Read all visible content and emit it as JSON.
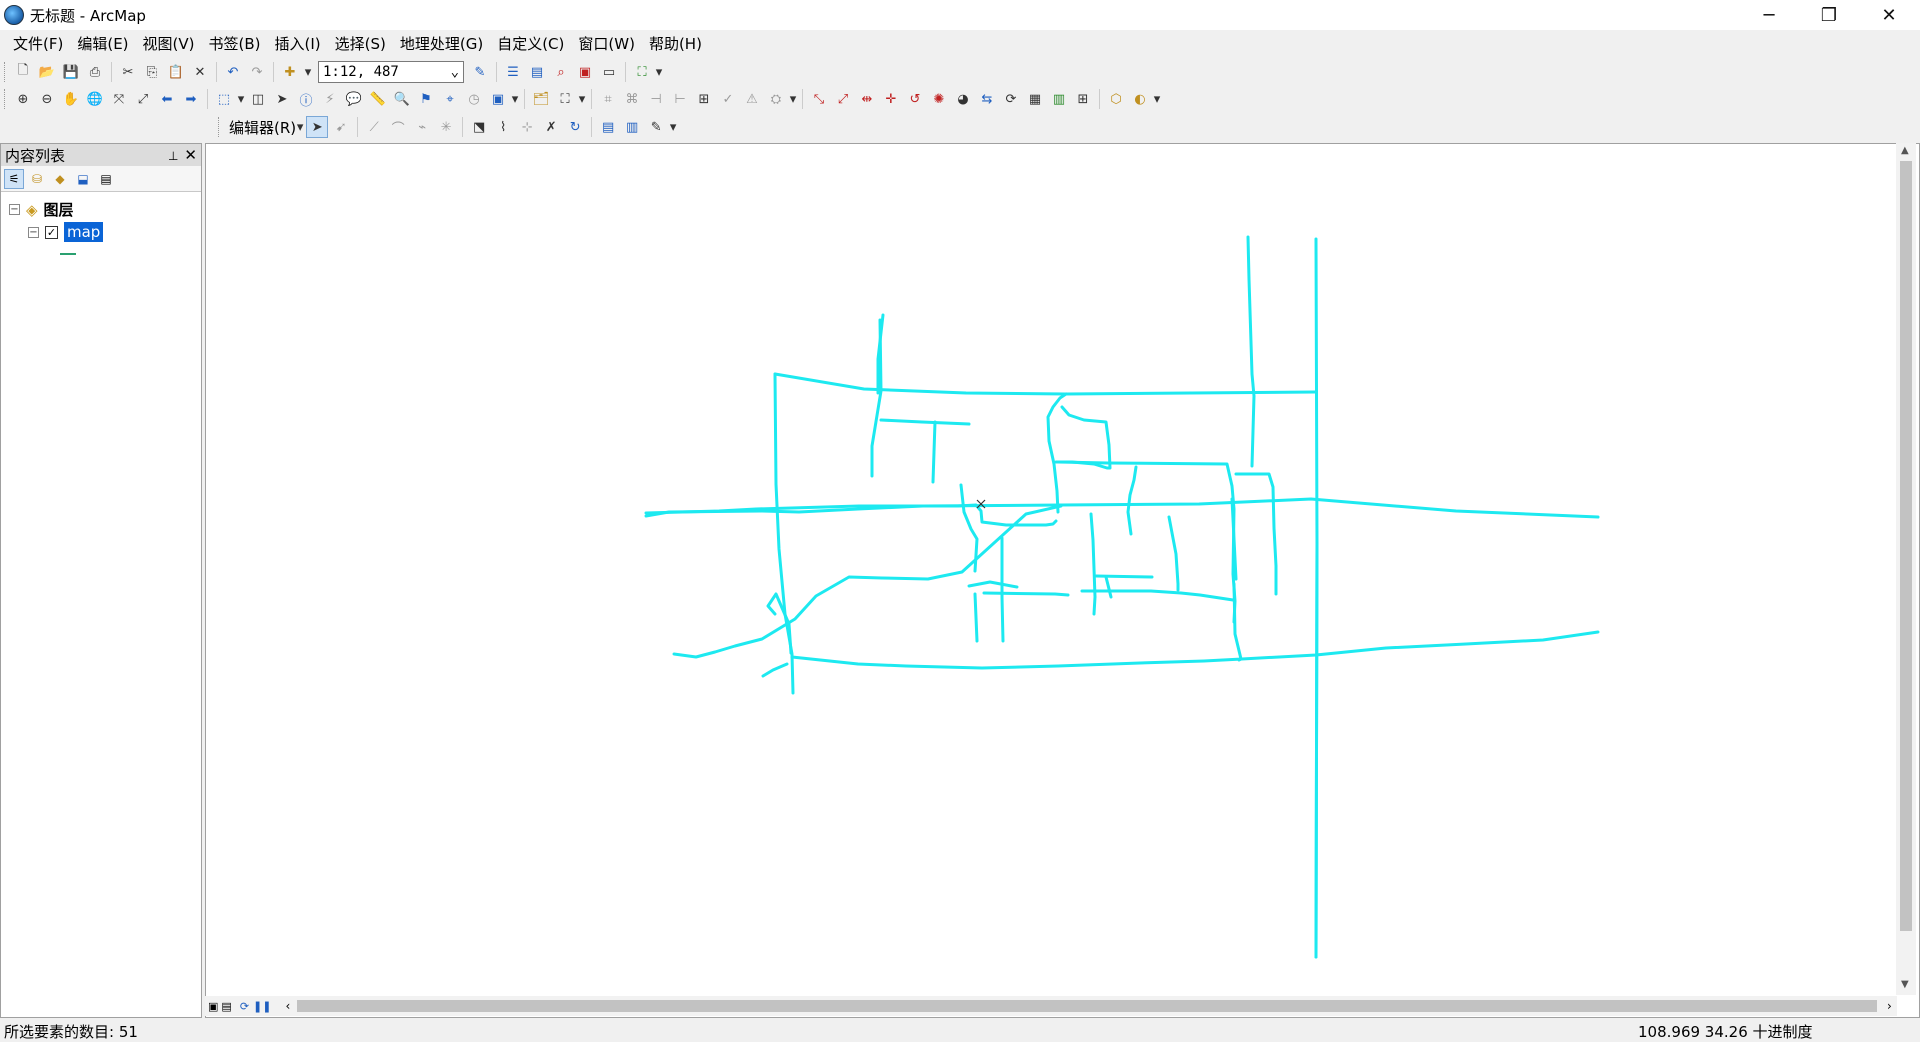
{
  "window": {
    "title": "无标题 - ArcMap"
  },
  "menu": [
    "文件(F)",
    "编辑(E)",
    "视图(V)",
    "书签(B)",
    "插入(I)",
    "选择(S)",
    "地理处理(G)",
    "自定义(C)",
    "窗口(W)",
    "帮助(H)"
  ],
  "toolbar": {
    "scale_value": "1:12, 487",
    "editor_label": "编辑器(R)"
  },
  "toc": {
    "title": "内容列表",
    "group_label": "图层",
    "layer_name": "map",
    "layer_checked": true
  },
  "status": {
    "selected_count": "所选要素的数目: 51",
    "coordinates": "108.969  34.26 十进制度"
  },
  "colors": {
    "feature_line": "#1de9f0",
    "selection": "#0a64d6"
  },
  "icons": [
    "app-globe-icon",
    "minimize-icon",
    "restore-icon",
    "close-icon",
    "pin-icon",
    "layers-icon"
  ]
}
